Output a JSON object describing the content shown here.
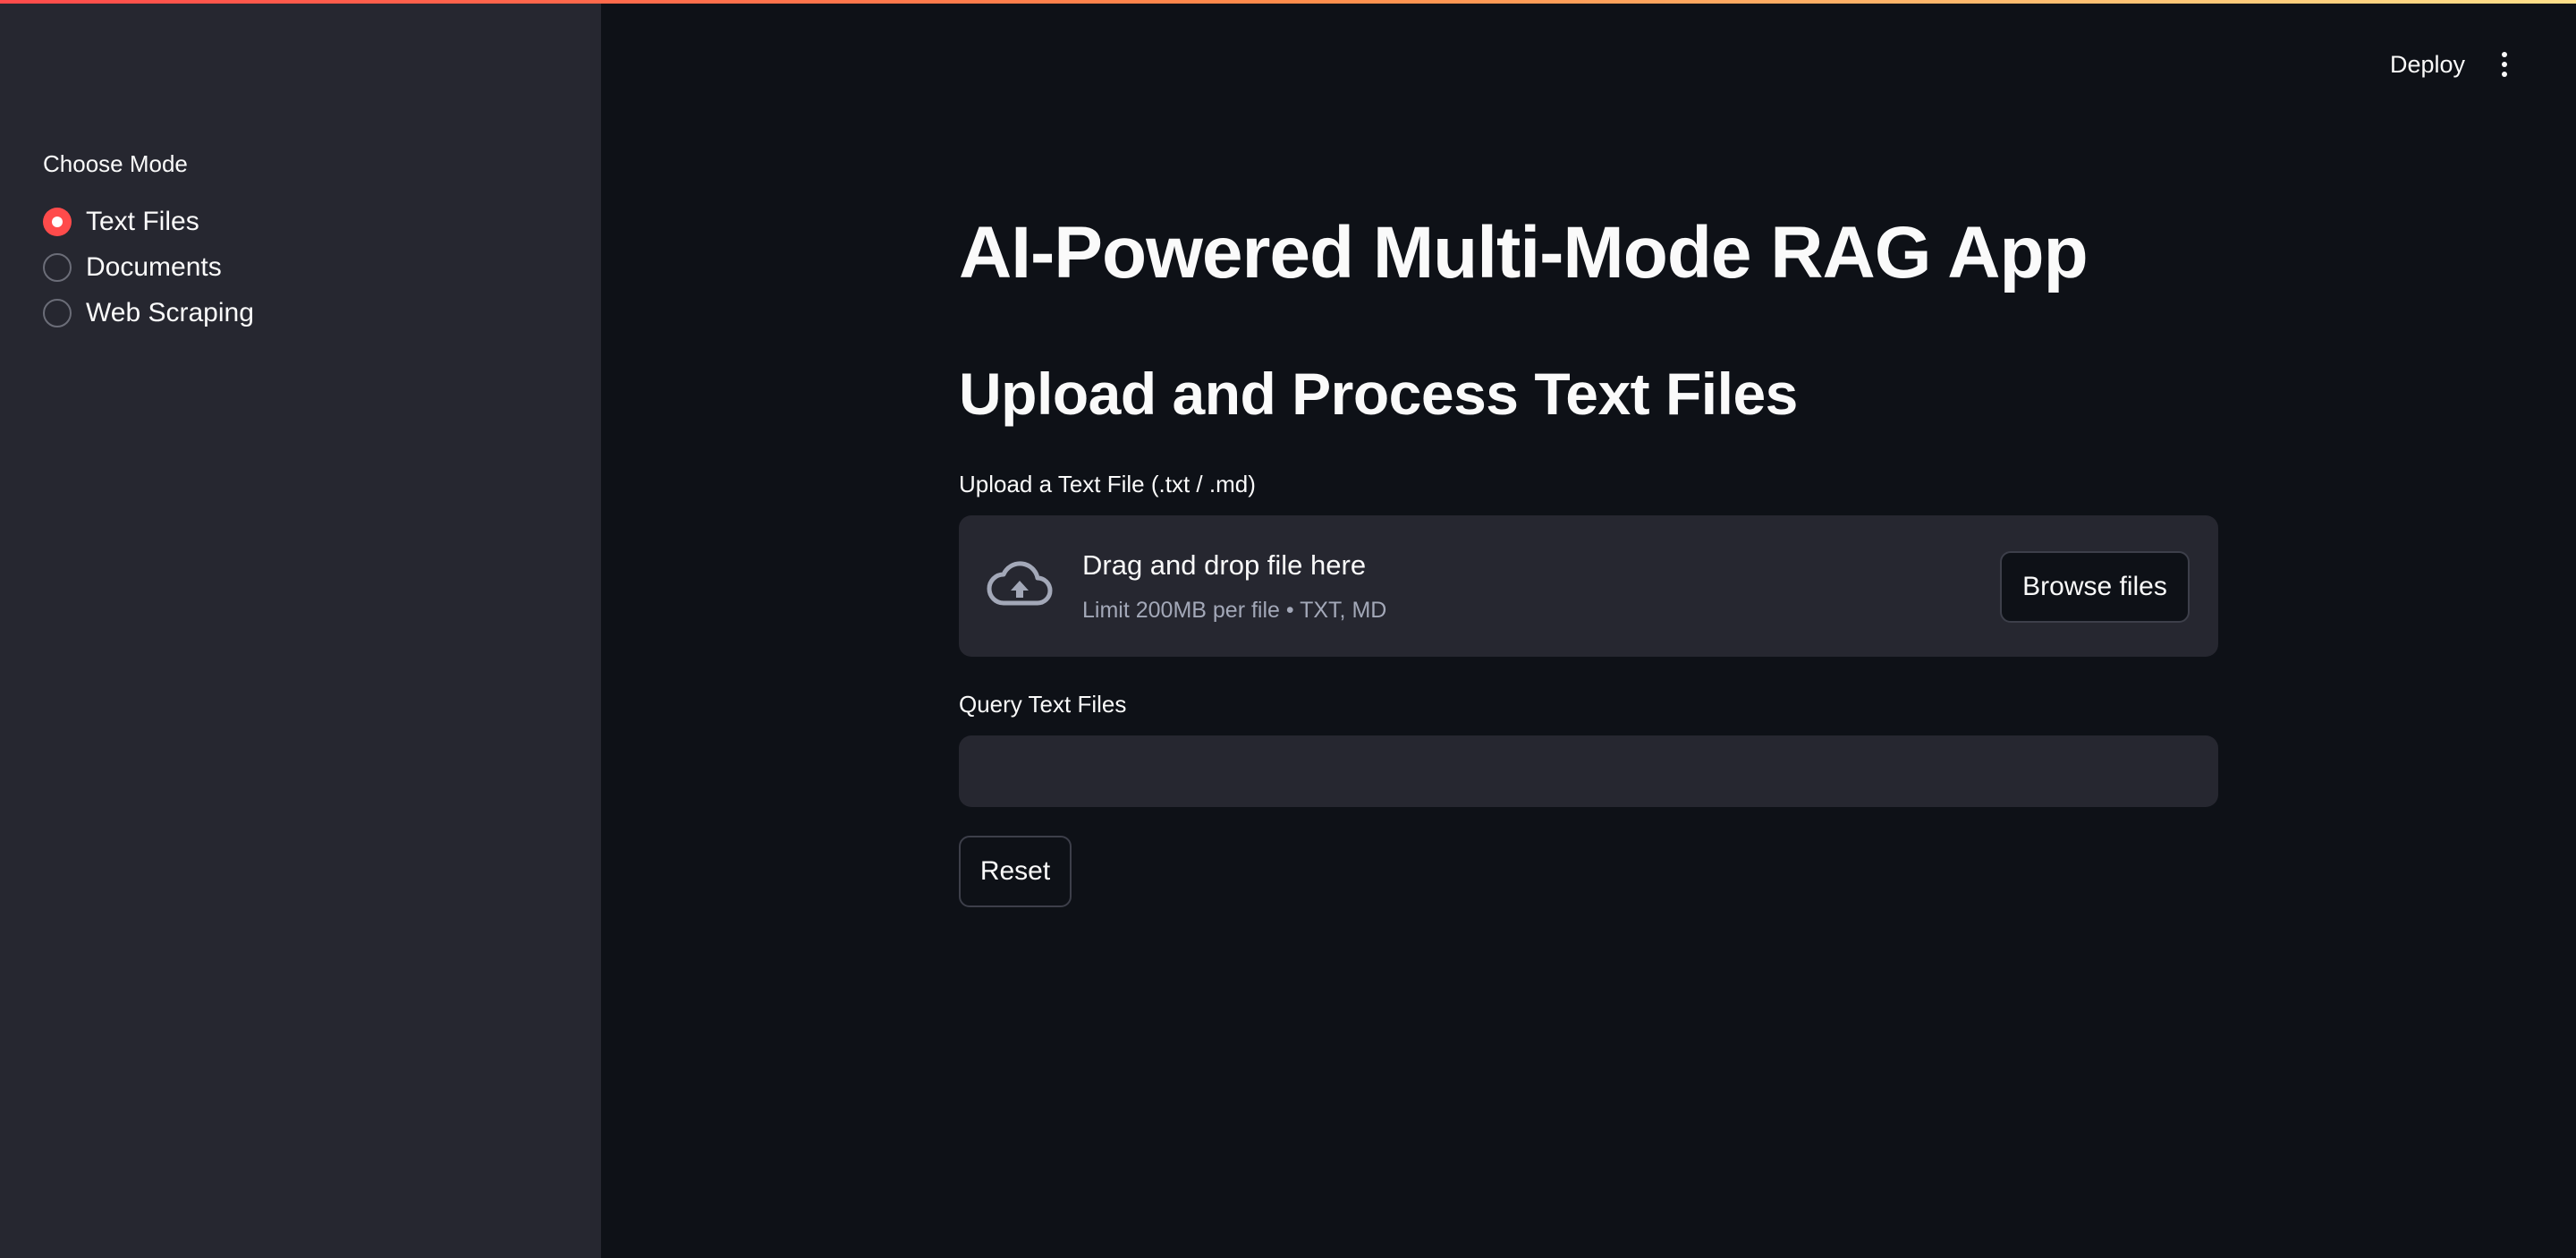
{
  "sidebar": {
    "mode_label": "Choose Mode",
    "modes": [
      {
        "label": "Text Files",
        "selected": true
      },
      {
        "label": "Documents",
        "selected": false
      },
      {
        "label": "Web Scraping",
        "selected": false
      }
    ]
  },
  "header": {
    "deploy_label": "Deploy",
    "menu_icon": "more-vertical-icon"
  },
  "main": {
    "app_title": "AI-Powered Multi-Mode RAG App",
    "section_title": "Upload and Process Text Files",
    "uploader": {
      "label": "Upload a Text File (.txt / .md)",
      "drop_text": "Drag and drop file here",
      "limit_text": "Limit 200MB per file • TXT, MD",
      "browse_label": "Browse files",
      "icon": "cloud-upload-icon"
    },
    "query": {
      "label": "Query Text Files",
      "value": "",
      "placeholder": ""
    },
    "reset_label": "Reset"
  },
  "colors": {
    "accent": "#ff4b4b",
    "background": "#0e1117",
    "sidebar": "#262730",
    "input": "#262730"
  }
}
